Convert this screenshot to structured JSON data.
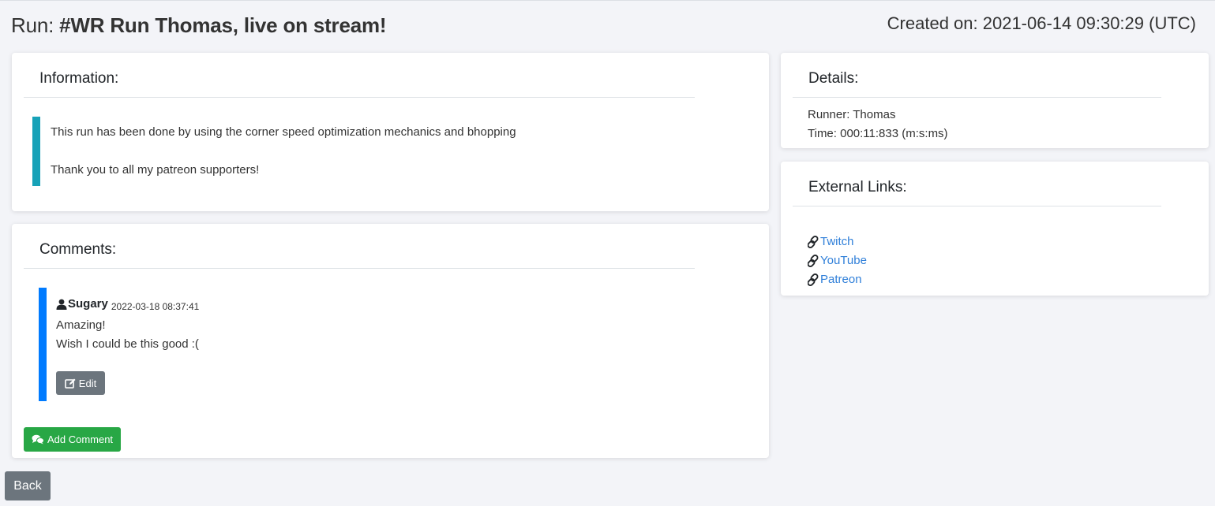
{
  "header": {
    "run_prefix": "Run: ",
    "run_name": "#WR Run Thomas, live on stream!",
    "created_label": "Created on: 2021-06-14 09:30:29 (UTC)"
  },
  "information": {
    "title": "Information:",
    "lines": [
      "This run has been done by using the corner speed optimization mechanics and bhopping",
      "Thank you to all my patreon supporters!"
    ]
  },
  "comments": {
    "title": "Comments:",
    "items": [
      {
        "user": "Sugary",
        "date": "2022-03-18 08:37:41",
        "lines": [
          "Amazing!",
          "Wish I could be this good :("
        ],
        "edit_label": "Edit"
      }
    ],
    "add_label": "Add Comment"
  },
  "details": {
    "title": "Details:",
    "runner": "Runner: Thomas",
    "time": "Time: 000:11:833 (m:s:ms)"
  },
  "external_links": {
    "title": "External Links:",
    "links": [
      {
        "label": "Twitch",
        "icon": "link-icon"
      },
      {
        "label": "YouTube",
        "icon": "link-icon"
      },
      {
        "label": "Patreon",
        "icon": "link-icon"
      }
    ]
  },
  "back_label": "Back",
  "colors": {
    "info_accent": "#17a2b8",
    "comment_accent": "#007bff",
    "success": "#28a745",
    "secondary": "#6c757d",
    "link": "#2f7fd9"
  }
}
